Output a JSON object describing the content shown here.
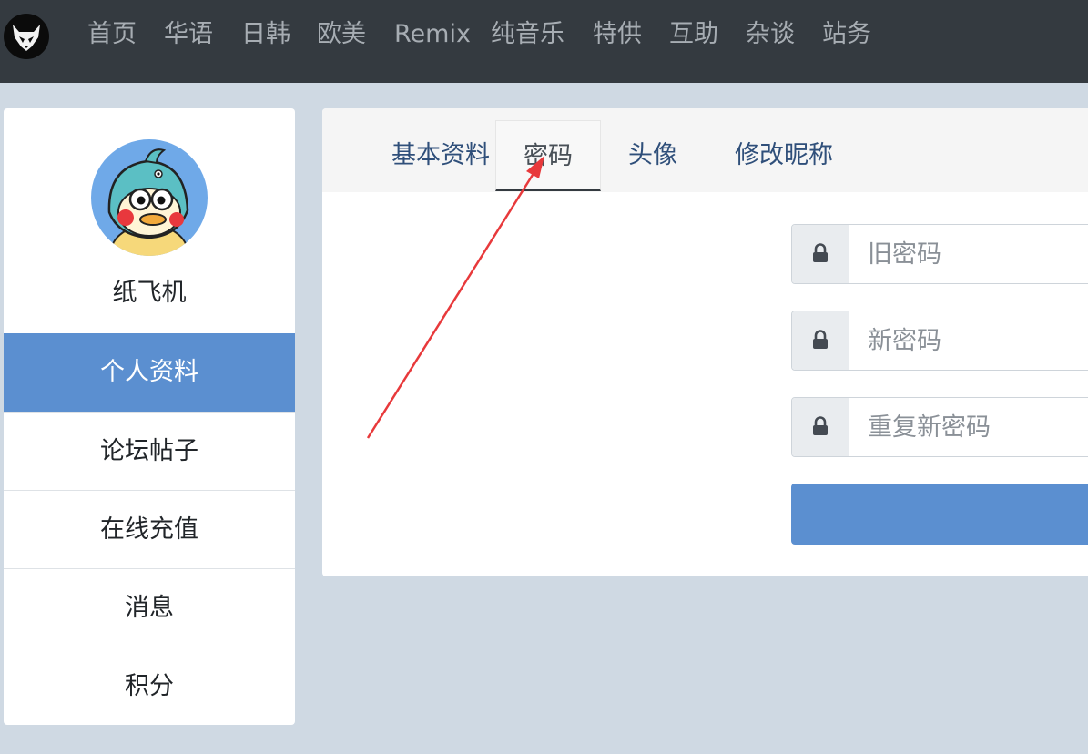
{
  "nav": {
    "items": [
      "首页",
      "华语",
      "日韩",
      "欧美",
      "Remix",
      "纯音乐",
      "特供",
      "互助",
      "杂谈",
      "站务"
    ]
  },
  "sidebar": {
    "username": "纸飞机",
    "items": [
      {
        "label": "个人资料",
        "active": true
      },
      {
        "label": "论坛帖子",
        "active": false
      },
      {
        "label": "在线充值",
        "active": false
      },
      {
        "label": "消息",
        "active": false
      },
      {
        "label": "积分",
        "active": false
      }
    ]
  },
  "tabs": [
    {
      "label": "基本资料",
      "active": false
    },
    {
      "label": "密码",
      "active": true
    },
    {
      "label": "头像",
      "active": false
    },
    {
      "label": "修改昵称",
      "active": false
    }
  ],
  "form": {
    "old_password_placeholder": "旧密码",
    "new_password_placeholder": "新密码",
    "repeat_password_placeholder": "重复新密码",
    "submit_label": ""
  },
  "colors": {
    "topbar": "#343a40",
    "accent": "#5b8fd0",
    "page_bg": "#cfd9e3",
    "annotation_arrow": "#e8393b"
  },
  "icons": {
    "logo": "horned-skull-logo-icon",
    "field": "lock-icon"
  }
}
